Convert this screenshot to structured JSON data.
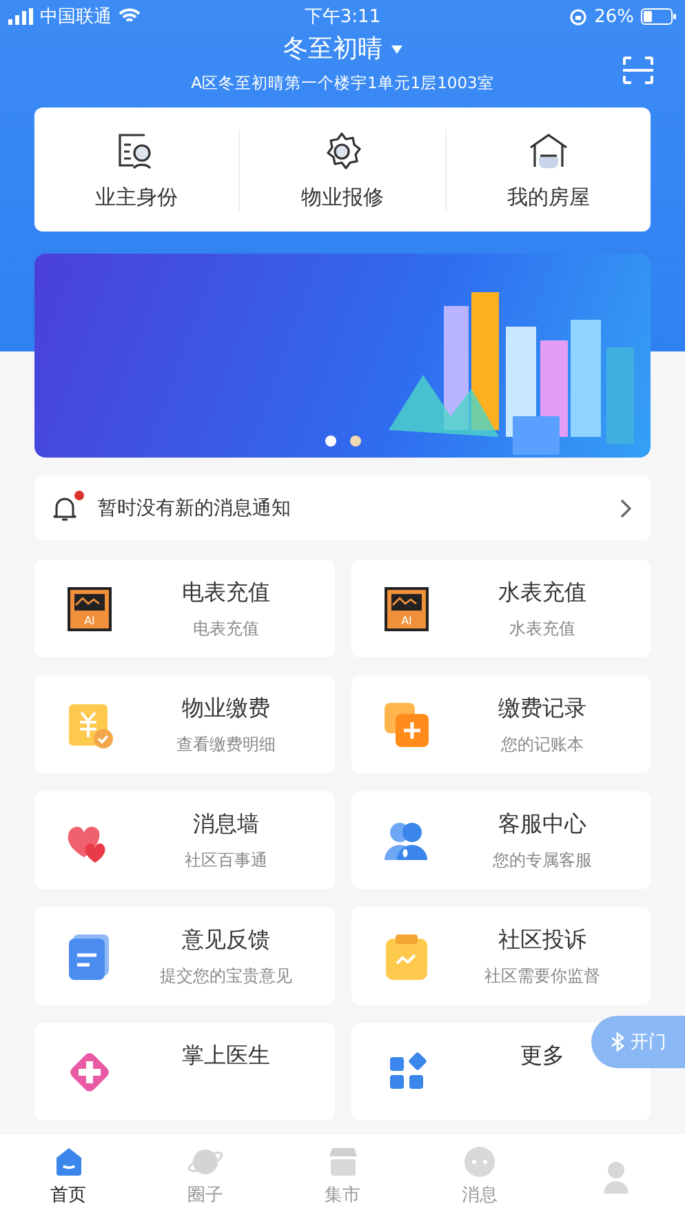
{
  "status_bar": {
    "carrier": "中国联通",
    "time": "下午3:11",
    "battery": "26%"
  },
  "header": {
    "title": "冬至初晴",
    "address": "A区冬至初晴第一个楼宇1单元1层1003室"
  },
  "quick_actions": [
    {
      "label": "业主身份"
    },
    {
      "label": "物业报修"
    },
    {
      "label": "我的房屋"
    }
  ],
  "banner": {
    "dots": [
      {
        "selected": true
      },
      {
        "selected": false
      }
    ]
  },
  "notice": {
    "text": "暂时没有新的消息通知",
    "unread": true
  },
  "services": [
    {
      "title": "电表充值",
      "subtitle": "电表充值",
      "icon_text": "AI"
    },
    {
      "title": "水表充值",
      "subtitle": "水表充值",
      "icon_text": "AI"
    },
    {
      "title": "物业缴费",
      "subtitle": "查看缴费明细"
    },
    {
      "title": "缴费记录",
      "subtitle": "您的记账本"
    },
    {
      "title": "消息墙",
      "subtitle": "社区百事通"
    },
    {
      "title": "客服中心",
      "subtitle": "您的专属客服"
    },
    {
      "title": "意见反馈",
      "subtitle": "提交您的宝贵意见"
    },
    {
      "title": "社区投诉",
      "subtitle": "社区需要你监督"
    },
    {
      "title": "掌上医生"
    },
    {
      "title": "更多"
    }
  ],
  "door_button": {
    "label": "开门"
  },
  "tab_bar": [
    {
      "label": "首页",
      "selected": true
    },
    {
      "label": "圈子",
      "selected": false
    },
    {
      "label": "集市",
      "selected": false
    },
    {
      "label": "消息",
      "selected": false
    },
    {
      "selected": false
    }
  ]
}
